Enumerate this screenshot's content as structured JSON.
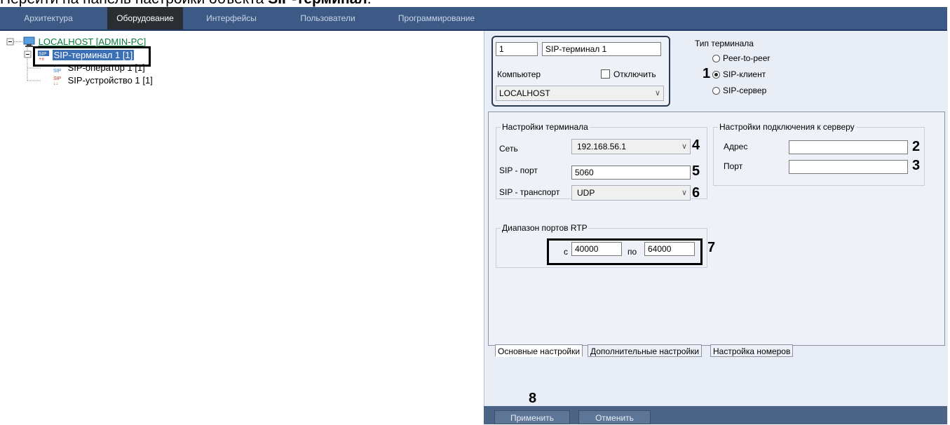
{
  "caption": {
    "prefix": "Перейти на панель настройки объекта ",
    "bold": "SIP-терминал",
    "suffix": "."
  },
  "menu": {
    "items": [
      "Архитектура",
      "Оборудование",
      "Интерфейсы",
      "Пользователи",
      "Программирование"
    ],
    "active": "Оборудование"
  },
  "tree": {
    "root": "LOCALHOST [ADMIN-PC]",
    "terminal": "SIP-терминал 1 [1]",
    "operator": "SIP-оператор 1 [1]",
    "device": "SIP-устройство 1 [1]"
  },
  "header": {
    "id_value": "1",
    "name_value": "SIP-терминал 1",
    "computer_label": "Компьютер",
    "disable_label": "Отключить",
    "computer_value": "LOCALHOST"
  },
  "terminal_type": {
    "title": "Тип терминала",
    "options": [
      "Peer-to-peer",
      "SIP-клиент",
      "SIP-сервер"
    ],
    "selected": "SIP-клиент"
  },
  "terminal_settings": {
    "title": "Настройки терминала",
    "network_label": "Сеть",
    "network_value": "192.168.56.1",
    "port_label": "SIP - порт",
    "port_value": "5060",
    "transport_label": "SIP - транспорт",
    "transport_value": "UDP"
  },
  "server_settings": {
    "title": "Настройки подключения к серверу",
    "address_label": "Адрес",
    "address_value": "",
    "port_label": "Порт",
    "port_value": ""
  },
  "rtp": {
    "title": "Диапазон портов RTP",
    "from_label": "с",
    "from_value": "40000",
    "to_label": "по",
    "to_value": "64000"
  },
  "tabs": [
    "Основные настройки",
    "Дополнительные настройки",
    "Настройка номеров"
  ],
  "buttons": {
    "apply": "Применить",
    "cancel": "Отменить"
  },
  "callouts": {
    "n1": "1",
    "n2": "2",
    "n3": "3",
    "n4": "4",
    "n5": "5",
    "n6": "6",
    "n7": "7",
    "n8": "8"
  },
  "colors": {
    "menu_bg": "#3d5a86",
    "menu_active": "#2a2e33",
    "panel_bg": "#e9edf5",
    "tree_link": "#0b7a3b",
    "selection": "#3b6fb6"
  }
}
